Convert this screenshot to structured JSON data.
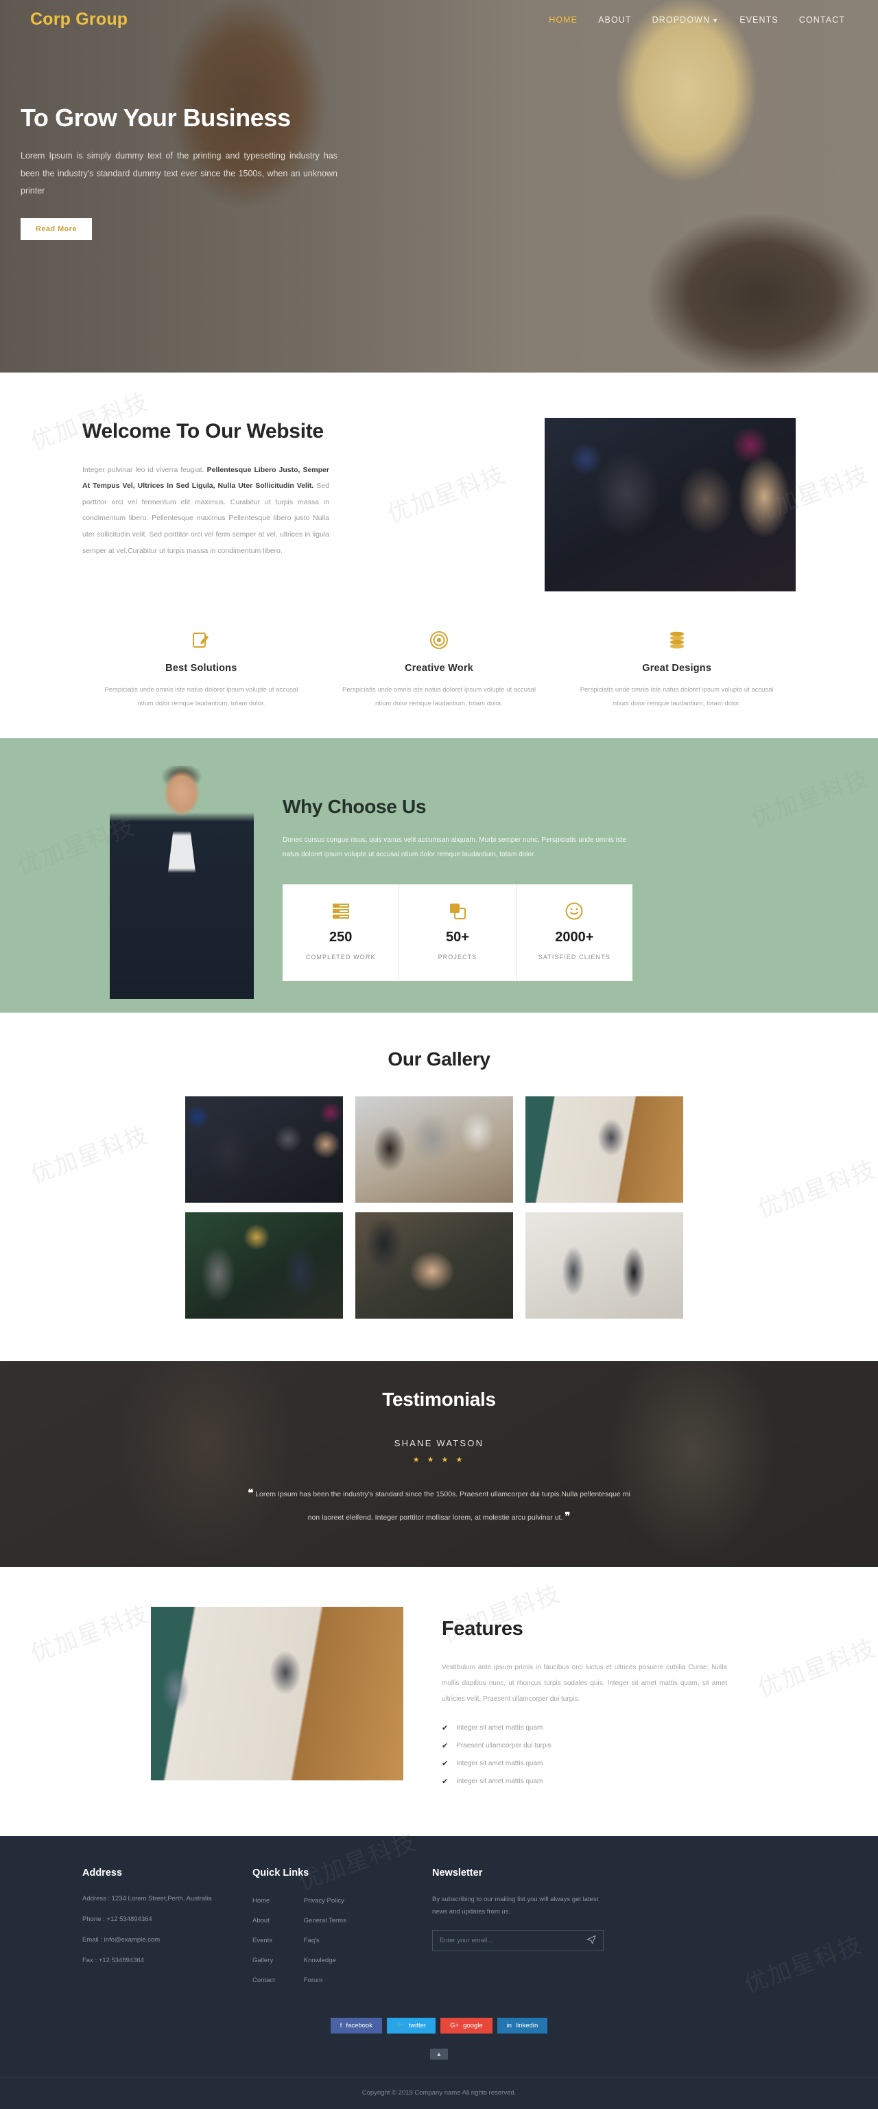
{
  "brand": "Corp Group",
  "nav": {
    "items": [
      {
        "label": "HOME",
        "active": true
      },
      {
        "label": "ABOUT",
        "active": false
      },
      {
        "label": "DROPDOWN",
        "active": false,
        "caret": true
      },
      {
        "label": "EVENTS",
        "active": false
      },
      {
        "label": "CONTACT",
        "active": false
      }
    ]
  },
  "hero": {
    "title": "To Grow Your Business",
    "text": "Lorem Ipsum is simply dummy text of the printing and typesetting industry has been the industry's standard dummy text ever since the 1500s, when an unknown printer",
    "button": "Read More"
  },
  "welcome": {
    "title": "Welcome To Our Website",
    "lead": "Integer pulvinar leo id viverra feugiat. ",
    "bold": "Pellentesque Libero Justo, Semper At Tempus Vel, Ultrices In Sed Ligula, Nulla Uter Sollicitudin Velit.",
    "rest": " Sed porttitor orci vel fermentum elit maximus. Curabitur ut turpis massa in condimentum libero. Pellentesque maximus Pellentesque libero justo Nulla uter sollicitudin velit. Sed porttitor orci vel ferm semper at vel, ultrices in ligula semper at vel.Curabitur ut turpis massa in condimentum libero."
  },
  "cards": [
    {
      "icon": "pencil-edit-icon",
      "title": "Best Solutions",
      "text": "Perspiciatis unde omnis iste natus doloret ipsum volupte ut accusal ntium dolor remque laudantium, totam dolor."
    },
    {
      "icon": "target-icon",
      "title": "Creative Work",
      "text": "Perspiciatis unde omnis iste natus doloret ipsum volupte ut accusal ntium dolor remque laudantium, totam dolor."
    },
    {
      "icon": "coins-icon",
      "title": "Great Designs",
      "text": "Perspiciatis unde omnis iste natus doloret ipsum volupte ut accusal ntium dolor remque laudantium, totam dolor."
    }
  ],
  "why": {
    "title": "Why Choose Us",
    "text": "Donec cursus congue risus, quis varius velit accumsan aliquam. Morbi semper nunc. Perspiciatis unde omnis iste natus doloret ipsum volupte ut accusal ntium dolor remque laudantium, totam dolor",
    "stats": [
      {
        "icon": "server-list-icon",
        "number": "250",
        "label": "COMPLETED WORK"
      },
      {
        "icon": "copy-files-icon",
        "number": "50+",
        "label": "PROJECTS"
      },
      {
        "icon": "smiley-face-icon",
        "number": "2000+",
        "label": "SATISFIED CLIENTS"
      }
    ]
  },
  "gallery": {
    "title": "Our Gallery",
    "items": [
      {
        "alt": "businessmen-handshake-at-bar"
      },
      {
        "alt": "team-meeting-with-laptop"
      },
      {
        "alt": "office-conference-mashrooms-wall"
      },
      {
        "alt": "two-men-shaking-hands-green-wall"
      },
      {
        "alt": "handshake-over-desk-closeup"
      },
      {
        "alt": "man-and-woman-handshake-lobby"
      }
    ]
  },
  "testimonials": {
    "title": "Testimonials",
    "name": "SHANE WATSON",
    "stars": "★ ★ ★ ★",
    "rating": 3.5,
    "quote_open": "❝",
    "quote": "Lorem Ipsum has been the industry's standard since the 1500s. Praesent ullamcorper dui turpis.Nulla pellentesque mi non laoreet eleifend. Integer porttitor mollisar lorem, at molestie arcu pulvinar ut.",
    "quote_close": "❞"
  },
  "features": {
    "title": "Features",
    "image_alt": "office-conference-mashrooms-wall",
    "paragraph": "Vestibulum ante ipsum primis in faucibus orci luctus et ultrices posuere cubilia Curae; Nulla mollis dapibus nunc, ut rhoncus turpis sodales quis. Integer sit amet mattis quam, sit amet ultricies velit. Praesent ullamcorper dui turpis.",
    "list": [
      "Integer sit amet mattis quam",
      "Praesent ullamcorper dui turpis",
      "Integer sit amet mattis quam",
      "Integer sit amet mattis quam"
    ]
  },
  "footer": {
    "address": {
      "heading": "Address",
      "lines": [
        "Address : 1234 Lorem Street,Perth, Australia",
        "Phone : +12 534894364",
        "Email : info@example.com",
        "Fax : +12 534894364"
      ]
    },
    "quick_links": {
      "heading": "Quick Links",
      "col1": [
        "Home",
        "About",
        "Events",
        "Gallery",
        "Contact"
      ],
      "col2": [
        "Privacy Policy",
        "General Terms",
        "Faq's",
        "Knowledge",
        "Forum"
      ]
    },
    "newsletter": {
      "heading": "Newsletter",
      "text": "By subscribing to our mailing list you will always get latest news and updates from us.",
      "placeholder": "Enter your email...",
      "value": "",
      "send_icon": "paper-plane-icon"
    },
    "socials": [
      {
        "name": "facebook",
        "glyph": "f",
        "color": "#4862a3"
      },
      {
        "name": "twitter",
        "glyph": "✔",
        "color": "#28a4e8"
      },
      {
        "name": "google",
        "glyph": "G+",
        "color": "#e8483a"
      },
      {
        "name": "linkedin",
        "glyph": "in",
        "color": "#2476b0"
      }
    ],
    "back_to_top": "▲",
    "copyright": "Copyright © 2019 Company name All rights reserved."
  },
  "watermark": "优加星科技",
  "colors": {
    "brand_gold": "#f0c040",
    "accent_gold": "#d6a42e",
    "why_green": "#9ebfa4",
    "footer_dark": "#232c38",
    "testimonial_dark": "#191818"
  }
}
